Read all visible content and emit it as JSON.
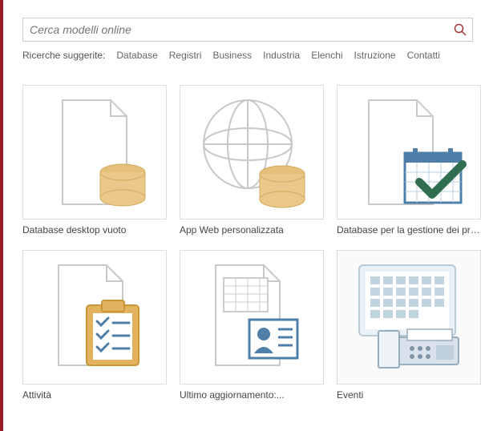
{
  "search": {
    "placeholder": "Cerca modelli online"
  },
  "suggestions": {
    "label": "Ricerche suggerite:",
    "items": [
      "Database",
      "Registri",
      "Business",
      "Industria",
      "Elenchi",
      "Istruzione",
      "Contatti"
    ]
  },
  "templates": [
    {
      "caption": "Database desktop vuoto"
    },
    {
      "caption": "App Web personalizzata"
    },
    {
      "caption": "Database per la gestione dei pro..."
    },
    {
      "caption": "Attività"
    },
    {
      "caption": "Ultimo aggiornamento:..."
    },
    {
      "caption": "Eventi"
    }
  ]
}
